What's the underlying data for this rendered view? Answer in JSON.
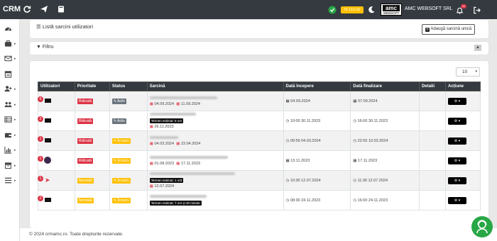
{
  "brand": "CRM",
  "header": {
    "credit": "112 cb",
    "company_name": "AMC WEBSOFT SRL",
    "logo_text": "amc",
    "logo_sub": "WEBSOFT",
    "notif_count": "11"
  },
  "colors": {
    "topbar": "#343a40",
    "danger": "#dc3545",
    "warning": "#ffc107",
    "success": "#28a745"
  },
  "sidebar": {
    "icons": [
      "dashboard-icon",
      "briefcase-icon",
      "envelope-icon",
      "calendar-icon",
      "user-plus-icon",
      "users-icon",
      "list-icon",
      "wallet-icon",
      "chart-icon",
      "archive-icon",
      "settings-list-icon"
    ]
  },
  "page": {
    "title": "Listă sarcini utilizatori",
    "add_button": "Adaugă sarcină unică",
    "filter": "Filtru",
    "page_size": "10"
  },
  "table": {
    "headers": [
      "Utilizatori",
      "Prioritate",
      "Status",
      "Sarcină",
      "Dată începere",
      "Dată finalizare",
      "Detalii",
      "Acțiune"
    ],
    "rows": [
      {
        "count": "6",
        "priority": "Ridicată",
        "status": "Activ",
        "date_a": "04.09.2024",
        "date_b": "11.09.2024",
        "estimate": "",
        "extra_date": "",
        "start": "04.09.2024",
        "end": "07.09.2024"
      },
      {
        "count": "2",
        "priority": "Ridicată",
        "status": "Activ",
        "date_a": "",
        "date_b": "",
        "estimate": "Termen estimat: 6 ore",
        "extra_date": "26.11.2023",
        "start": "10:00 30.11.2023",
        "end": "16:00 30.11.2023"
      },
      {
        "count": "1",
        "priority": "Ridicată",
        "status": "În lucru",
        "date_a": "04.03.2024",
        "date_b": "23.04.2024",
        "estimate": "",
        "extra_date": "",
        "start": "09:59 04.03.2024",
        "end": "22:00 10.03.2024"
      },
      {
        "count": "1",
        "priority": "Ridicată",
        "status": "În lucru",
        "date_a": "01.08.2023",
        "date_b": "17.11.2023",
        "estimate": "",
        "extra_date": "",
        "start": "13.11.2023",
        "end": "17.11.2023"
      },
      {
        "count": "1",
        "priority": "Normală",
        "status": "În lucru",
        "date_a": "",
        "date_b": "",
        "estimate": "Termen estimat: 1 oră",
        "extra_date": "12.07.2024",
        "start": "10:30 12.07.2024",
        "end": "11:30 12.07.2024"
      },
      {
        "count": "2",
        "priority": "Normală",
        "status": "În lucru",
        "date_a": "",
        "date_b": "",
        "estimate": "Termen estimat: 7 ore și 30 minute",
        "extra_date": "",
        "start": "08:30 24.11.2023",
        "end": "16:00 24.11.2023"
      }
    ]
  },
  "footer": "© 2024 crmamc.ro. Toate drepturile rezervate."
}
